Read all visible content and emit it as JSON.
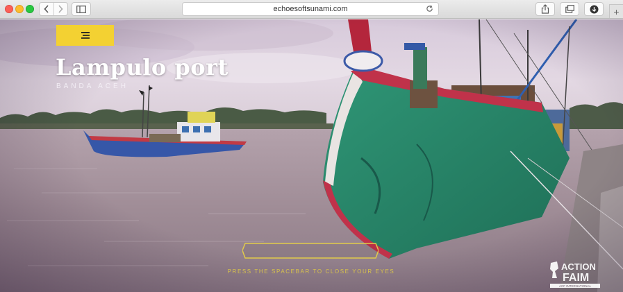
{
  "browser": {
    "url": "echoesoftsunami.com"
  },
  "page": {
    "title": "Lampulo port",
    "subtitle": "BANDA ACEH",
    "hint": "PRESS THE SPACEBAR TO CLOSE YOUR EYES",
    "logo_line1": "ACTION",
    "logo_line2": "FAIM",
    "logo_tagline": "ACF INTERNATIONAL"
  },
  "colors": {
    "accent_yellow": "#f3d132",
    "hint_gold": "#d9c34a"
  },
  "icons": {
    "menu": "hamburger-icon",
    "back": "chevron-left-icon",
    "forward": "chevron-right-icon",
    "sidebar": "sidebar-icon",
    "reload": "reload-icon",
    "share": "share-icon",
    "tabs": "tabs-icon",
    "downloads": "download-icon",
    "new_tab": "plus-icon"
  }
}
